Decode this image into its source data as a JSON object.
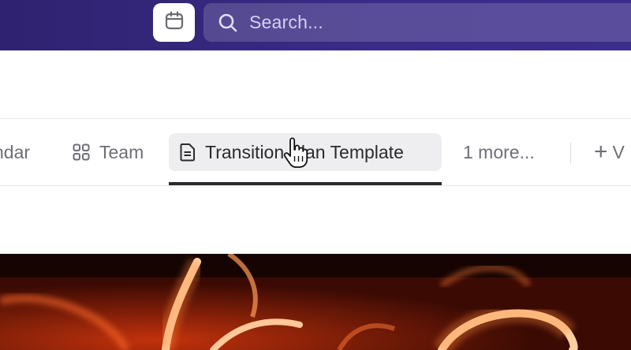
{
  "topbar": {
    "calendar_icon": "calendar-icon",
    "search": {
      "icon": "search-icon",
      "placeholder": "Search..."
    }
  },
  "view_tabs": {
    "items": [
      {
        "label": "ndar",
        "icon": "calendar-icon"
      },
      {
        "label": "Team",
        "icon": "grid-icon"
      },
      {
        "label": "Transition Plan Template",
        "icon": "document-icon",
        "active": true
      },
      {
        "label": "1 more..."
      },
      {
        "label": "V",
        "icon": "plus-icon"
      }
    ]
  },
  "colors": {
    "topbar": "#34267c",
    "active_tab_bg": "#eeeef0",
    "active_underline": "#2b2b2f",
    "banner_glow": "#ff8a3a"
  }
}
